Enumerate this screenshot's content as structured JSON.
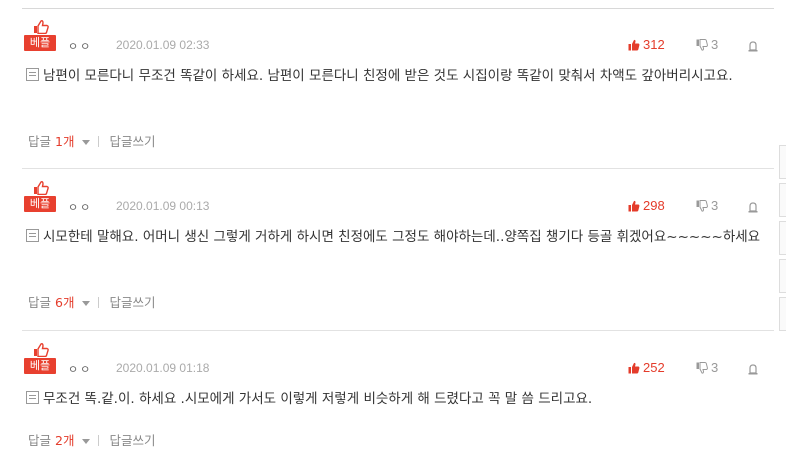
{
  "comments": [
    {
      "best_label": "베플",
      "nickname": "ㅇㅇ",
      "date": "2020.01.09 02:33",
      "likes": "312",
      "dislikes": "3",
      "text": "남편이 모른다니 무조건 똑같이 하세요. 남편이 모른다니 친정에 받은 것도 시집이랑 똑같이 맞춰서 차액도 갚아버리시고요.",
      "reply_label": "답글",
      "reply_count": "1개",
      "write_reply": "답글쓰기"
    },
    {
      "best_label": "베플",
      "nickname": "ㅇㅇ",
      "date": "2020.01.09 00:13",
      "likes": "298",
      "dislikes": "3",
      "text": "시모한테 말해요. 어머니 생신 그렇게 거하게 하시면 친정에도 그정도 해야하는데..양쪽집 챙기다 등골 휘겠어요~~~~~하세요",
      "reply_label": "답글",
      "reply_count": "6개",
      "write_reply": "답글쓰기"
    },
    {
      "best_label": "베플",
      "nickname": "ㅇㅇ",
      "date": "2020.01.09 01:18",
      "likes": "252",
      "dislikes": "3",
      "text": "무조건 똑.같.이. 하세요 .시모에게 가서도 이렇게 저렇게 비슷하게 해 드렸다고 꼭 말 씀 드리고요.",
      "reply_label": "답글",
      "reply_count": "2개",
      "write_reply": "답글쓰기"
    }
  ],
  "colors": {
    "accent": "#e8402f",
    "like": "#e43c2b",
    "muted": "#aaaaaa"
  },
  "icons": [
    "thumbs-up-icon",
    "like-icon",
    "dislike-icon",
    "report-icon",
    "memo-icon",
    "caret-down-icon"
  ]
}
